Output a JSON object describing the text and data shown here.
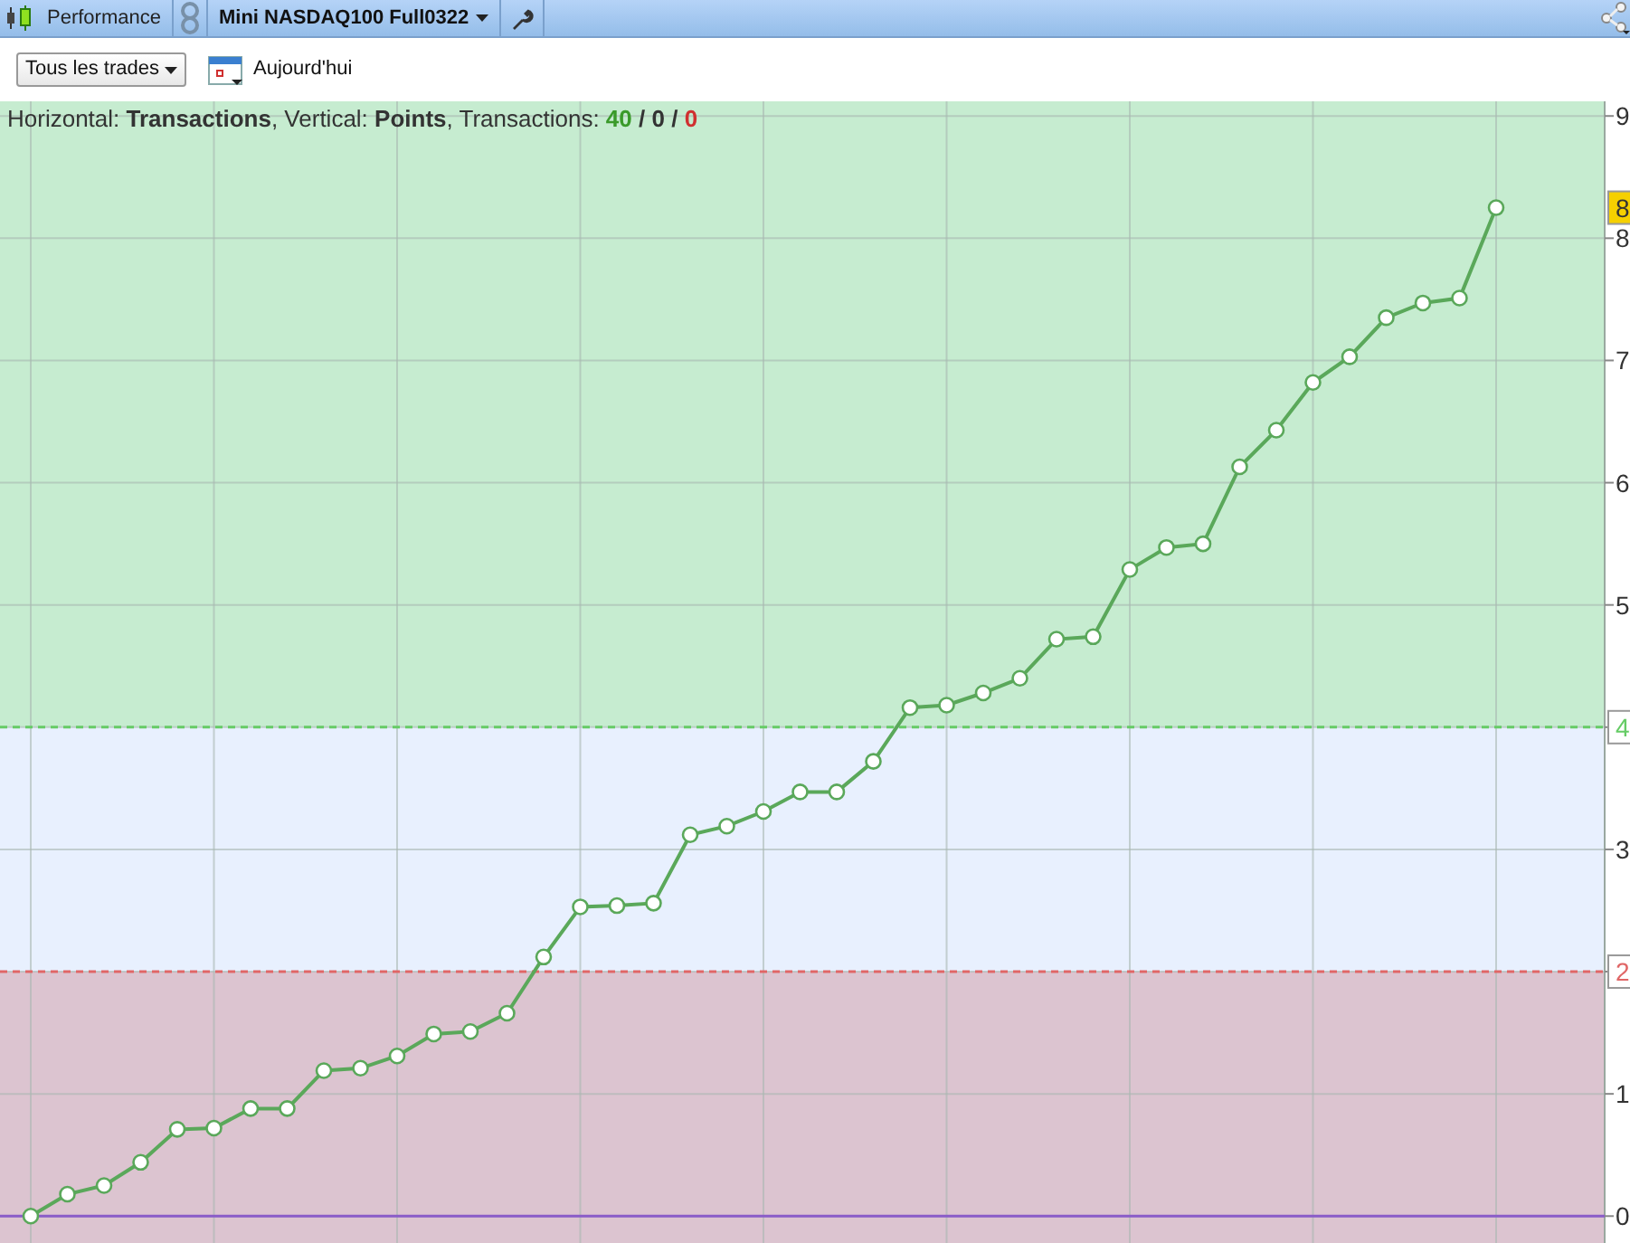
{
  "toolbar": {
    "tab": "Performance",
    "instrument": "Mini NASDAQ100 Full0322"
  },
  "filters": {
    "trades_dropdown": "Tous les trades",
    "date_button": "Aujourd'hui"
  },
  "summary": {
    "text": "Horizontal: **Transactions**, Vertical: **Points**, Transactions: ",
    "counts": [
      {
        "value": "40",
        "color": "#3a9a2a"
      },
      {
        "value": "0",
        "color": "#333333"
      },
      {
        "value": "0",
        "color": "#d03030"
      }
    ],
    "separator": "/"
  },
  "chart_data": {
    "type": "line",
    "ylim": [
      -0.22,
      9.12
    ],
    "grid": true,
    "yticks": [
      {
        "value": 0,
        "label": "0"
      },
      {
        "value": 1,
        "label": "1"
      },
      {
        "value": 2,
        "label": "2"
      },
      {
        "value": 3,
        "label": "3"
      },
      {
        "value": 4,
        "label": "4"
      },
      {
        "value": 5,
        "label": "5"
      },
      {
        "value": 6,
        "label": "6"
      },
      {
        "value": 7,
        "label": "7"
      },
      {
        "value": 8,
        "label": "8"
      },
      {
        "value": 9,
        "label": "9"
      }
    ],
    "categories": [
      null,
      null,
      null,
      null,
      null,
      null,
      null,
      null,
      null,
      null,
      null,
      null,
      null,
      null,
      null,
      null,
      null,
      null,
      null,
      null,
      null,
      null,
      null,
      null,
      null,
      null,
      null,
      null,
      null,
      null,
      null,
      null,
      null,
      null,
      null,
      null,
      null,
      null,
      null,
      null,
      null
    ],
    "series": [
      {
        "color": "#5aa85a",
        "marker": "o",
        "values": [
          0,
          0.18,
          0.25,
          0.44,
          0.71,
          0.72,
          0.88,
          0.88,
          1.19,
          1.21,
          1.31,
          1.49,
          1.51,
          1.66,
          2.12,
          2.53,
          2.54,
          2.56,
          3.12,
          3.19,
          3.31,
          3.47,
          3.47,
          3.72,
          4.16,
          4.18,
          4.28,
          4.4,
          4.72,
          4.74,
          5.29,
          5.47,
          5.5,
          6.13,
          6.43,
          6.82,
          7.03,
          7.35,
          7.47,
          7.51,
          8.25
        ]
      }
    ],
    "bands": [
      {
        "axis": "y",
        "from": 4,
        "to": 9.12,
        "color": "#c6ecd0"
      },
      {
        "axis": "y",
        "from": 2,
        "to": 4,
        "color": "#e8f0fe"
      },
      {
        "axis": "y",
        "from": -0.22,
        "to": 2,
        "color": "#dcc4d0"
      }
    ],
    "ref_lines": [
      {
        "axis": "y",
        "value": 4,
        "color": "#66cc66"
      },
      {
        "axis": "y",
        "value": 2,
        "color": "#e06666"
      },
      {
        "axis": "y",
        "value": 0,
        "color": "#8a5cc8"
      }
    ],
    "annotations": [
      {
        "text": "8"
      }
    ]
  }
}
